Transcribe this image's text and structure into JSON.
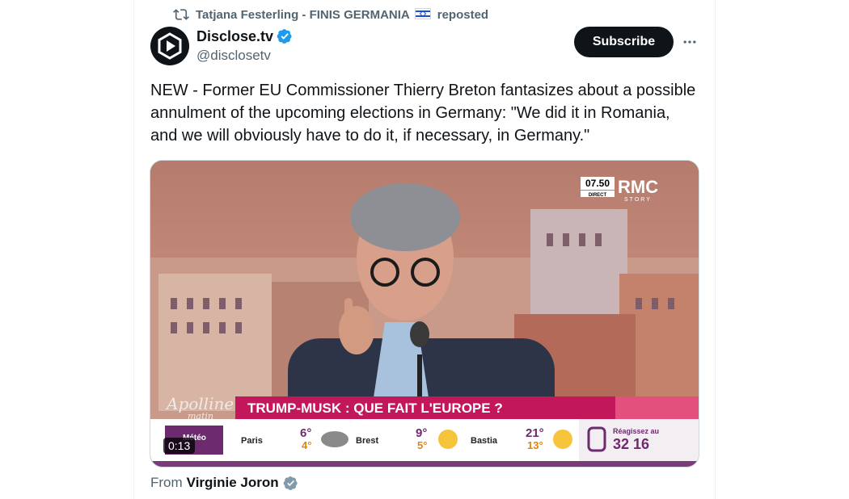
{
  "repost": {
    "user": "Tatjana Festerling - FINIS GERMANIA",
    "suffix": "reposted"
  },
  "author": {
    "name": "Disclose.tv",
    "handle": "@disclosetv"
  },
  "subscribe_label": "Subscribe",
  "tweet_text": "NEW - Former EU Commissioner Thierry Breton fantasizes about a possible annulment of the upcoming elections in Germany: \"We did it in Romania, and we will obviously have to do it, if necessary, in Germany.\"",
  "video": {
    "duration": "0:13",
    "channel": "RMC",
    "channel_sub": "STORY",
    "time_badge": "07.50",
    "direct": "DIRECT",
    "show": "Apolline",
    "show_sub": "matin",
    "banner": "TRUMP-MUSK : QUE FAIT L'EUROPE ?",
    "weather_label": "Météo",
    "weather": [
      {
        "city": "Paris",
        "high": "6°",
        "low": "4°"
      },
      {
        "city": "Brest",
        "high": "9°",
        "low": "5°"
      },
      {
        "city": "Bastia",
        "high": "21°",
        "low": "13°"
      }
    ],
    "react_label": "Réagissez au",
    "react_number": "32 16"
  },
  "from": {
    "prefix": "From",
    "name": "Virginie Joron"
  },
  "colors": {
    "verified": "#1d9bf0",
    "grey_verified": "#829aab",
    "banner": "#c2185b"
  }
}
